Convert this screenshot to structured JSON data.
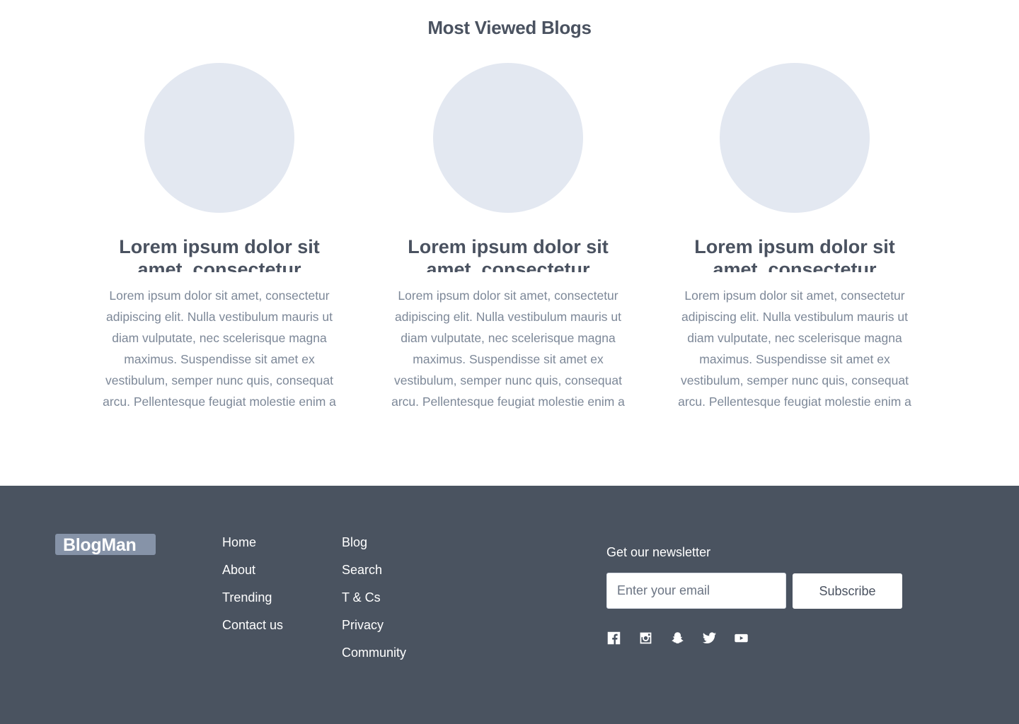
{
  "section": {
    "title": "Most Viewed Blogs"
  },
  "cards": [
    {
      "title": "Lorem ipsum dolor sit amet, consectetur",
      "excerpt": "Lorem ipsum dolor sit amet, consectetur adipiscing elit. Nulla vestibulum mauris ut diam vulputate, nec scelerisque magna maximus. Suspendisse sit amet ex vestibulum, semper nunc quis, consequat arcu. Pellentesque feugiat molestie enim a"
    },
    {
      "title": "Lorem ipsum dolor sit amet, consectetur",
      "excerpt": "Lorem ipsum dolor sit amet, consectetur adipiscing elit. Nulla vestibulum mauris ut diam vulputate, nec scelerisque magna maximus. Suspendisse sit amet ex vestibulum, semper nunc quis, consequat arcu. Pellentesque feugiat molestie enim a"
    },
    {
      "title": "Lorem ipsum dolor sit amet, consectetur",
      "excerpt": "Lorem ipsum dolor sit amet, consectetur adipiscing elit. Nulla vestibulum mauris ut diam vulputate, nec scelerisque magna maximus. Suspendisse sit amet ex vestibulum, semper nunc quis, consequat arcu. Pellentesque feugiat molestie enim a"
    }
  ],
  "footer": {
    "logo": "BlogMan",
    "nav_col_1": [
      "Home",
      "About",
      "Trending",
      "Contact us"
    ],
    "nav_col_2": [
      "Blog",
      "Search",
      "T & Cs",
      "Privacy",
      "Community"
    ],
    "newsletter": {
      "label": "Get our newsletter",
      "placeholder": "Enter your email",
      "button": "Subscribe"
    },
    "social_icons": [
      "facebook-icon",
      "instagram-icon",
      "snapchat-icon",
      "twitter-icon",
      "youtube-icon"
    ]
  },
  "colors": {
    "footer_bg": "#4a5360",
    "logo_bg": "#8693a8",
    "thumb_bg": "#e3e8f1",
    "heading": "#4a5260",
    "body_text": "#7d8898"
  }
}
